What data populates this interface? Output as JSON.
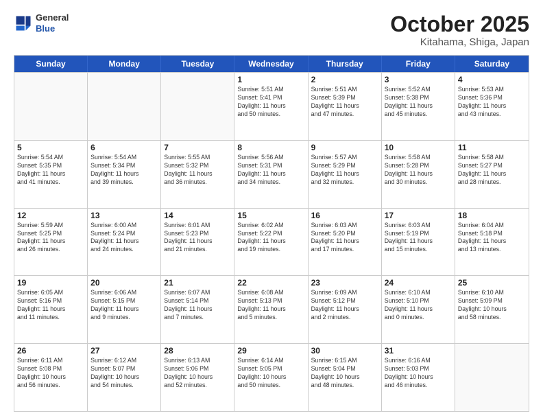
{
  "header": {
    "logo": {
      "general": "General",
      "blue": "Blue"
    },
    "title": "October 2025",
    "subtitle": "Kitahama, Shiga, Japan"
  },
  "weekdays": [
    "Sunday",
    "Monday",
    "Tuesday",
    "Wednesday",
    "Thursday",
    "Friday",
    "Saturday"
  ],
  "rows": [
    [
      {
        "day": "",
        "info": ""
      },
      {
        "day": "",
        "info": ""
      },
      {
        "day": "",
        "info": ""
      },
      {
        "day": "1",
        "info": "Sunrise: 5:51 AM\nSunset: 5:41 PM\nDaylight: 11 hours\nand 50 minutes."
      },
      {
        "day": "2",
        "info": "Sunrise: 5:51 AM\nSunset: 5:39 PM\nDaylight: 11 hours\nand 47 minutes."
      },
      {
        "day": "3",
        "info": "Sunrise: 5:52 AM\nSunset: 5:38 PM\nDaylight: 11 hours\nand 45 minutes."
      },
      {
        "day": "4",
        "info": "Sunrise: 5:53 AM\nSunset: 5:36 PM\nDaylight: 11 hours\nand 43 minutes."
      }
    ],
    [
      {
        "day": "5",
        "info": "Sunrise: 5:54 AM\nSunset: 5:35 PM\nDaylight: 11 hours\nand 41 minutes."
      },
      {
        "day": "6",
        "info": "Sunrise: 5:54 AM\nSunset: 5:34 PM\nDaylight: 11 hours\nand 39 minutes."
      },
      {
        "day": "7",
        "info": "Sunrise: 5:55 AM\nSunset: 5:32 PM\nDaylight: 11 hours\nand 36 minutes."
      },
      {
        "day": "8",
        "info": "Sunrise: 5:56 AM\nSunset: 5:31 PM\nDaylight: 11 hours\nand 34 minutes."
      },
      {
        "day": "9",
        "info": "Sunrise: 5:57 AM\nSunset: 5:29 PM\nDaylight: 11 hours\nand 32 minutes."
      },
      {
        "day": "10",
        "info": "Sunrise: 5:58 AM\nSunset: 5:28 PM\nDaylight: 11 hours\nand 30 minutes."
      },
      {
        "day": "11",
        "info": "Sunrise: 5:58 AM\nSunset: 5:27 PM\nDaylight: 11 hours\nand 28 minutes."
      }
    ],
    [
      {
        "day": "12",
        "info": "Sunrise: 5:59 AM\nSunset: 5:25 PM\nDaylight: 11 hours\nand 26 minutes."
      },
      {
        "day": "13",
        "info": "Sunrise: 6:00 AM\nSunset: 5:24 PM\nDaylight: 11 hours\nand 24 minutes."
      },
      {
        "day": "14",
        "info": "Sunrise: 6:01 AM\nSunset: 5:23 PM\nDaylight: 11 hours\nand 21 minutes."
      },
      {
        "day": "15",
        "info": "Sunrise: 6:02 AM\nSunset: 5:22 PM\nDaylight: 11 hours\nand 19 minutes."
      },
      {
        "day": "16",
        "info": "Sunrise: 6:03 AM\nSunset: 5:20 PM\nDaylight: 11 hours\nand 17 minutes."
      },
      {
        "day": "17",
        "info": "Sunrise: 6:03 AM\nSunset: 5:19 PM\nDaylight: 11 hours\nand 15 minutes."
      },
      {
        "day": "18",
        "info": "Sunrise: 6:04 AM\nSunset: 5:18 PM\nDaylight: 11 hours\nand 13 minutes."
      }
    ],
    [
      {
        "day": "19",
        "info": "Sunrise: 6:05 AM\nSunset: 5:16 PM\nDaylight: 11 hours\nand 11 minutes."
      },
      {
        "day": "20",
        "info": "Sunrise: 6:06 AM\nSunset: 5:15 PM\nDaylight: 11 hours\nand 9 minutes."
      },
      {
        "day": "21",
        "info": "Sunrise: 6:07 AM\nSunset: 5:14 PM\nDaylight: 11 hours\nand 7 minutes."
      },
      {
        "day": "22",
        "info": "Sunrise: 6:08 AM\nSunset: 5:13 PM\nDaylight: 11 hours\nand 5 minutes."
      },
      {
        "day": "23",
        "info": "Sunrise: 6:09 AM\nSunset: 5:12 PM\nDaylight: 11 hours\nand 2 minutes."
      },
      {
        "day": "24",
        "info": "Sunrise: 6:10 AM\nSunset: 5:10 PM\nDaylight: 11 hours\nand 0 minutes."
      },
      {
        "day": "25",
        "info": "Sunrise: 6:10 AM\nSunset: 5:09 PM\nDaylight: 10 hours\nand 58 minutes."
      }
    ],
    [
      {
        "day": "26",
        "info": "Sunrise: 6:11 AM\nSunset: 5:08 PM\nDaylight: 10 hours\nand 56 minutes."
      },
      {
        "day": "27",
        "info": "Sunrise: 6:12 AM\nSunset: 5:07 PM\nDaylight: 10 hours\nand 54 minutes."
      },
      {
        "day": "28",
        "info": "Sunrise: 6:13 AM\nSunset: 5:06 PM\nDaylight: 10 hours\nand 52 minutes."
      },
      {
        "day": "29",
        "info": "Sunrise: 6:14 AM\nSunset: 5:05 PM\nDaylight: 10 hours\nand 50 minutes."
      },
      {
        "day": "30",
        "info": "Sunrise: 6:15 AM\nSunset: 5:04 PM\nDaylight: 10 hours\nand 48 minutes."
      },
      {
        "day": "31",
        "info": "Sunrise: 6:16 AM\nSunset: 5:03 PM\nDaylight: 10 hours\nand 46 minutes."
      },
      {
        "day": "",
        "info": ""
      }
    ]
  ]
}
